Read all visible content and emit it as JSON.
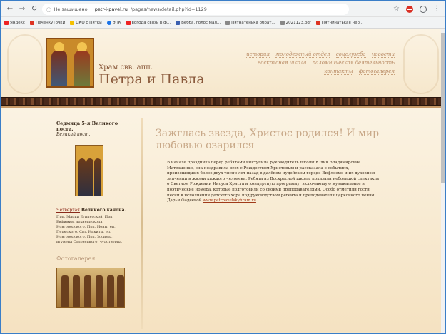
{
  "browser": {
    "url_prefix": "Не защищено",
    "url_host": "petr-i-pavel.ru",
    "url_path": "/pages/news/detail.php?id=1129",
    "bookmarks": [
      {
        "label": "Яндекс",
        "color": "#e22"
      },
      {
        "label": "ПечёнкуТочки",
        "color": "#d32"
      },
      {
        "label": "ЦКО с Пятки",
        "color": "#f5c000"
      },
      {
        "label": "ЭПК",
        "color": "#1a73e8"
      },
      {
        "label": "вогода связь р.ф...",
        "color": "#e22"
      },
      {
        "label": "Вебба. голос мал...",
        "color": "#3a5fb0"
      },
      {
        "label": "Пятнатенька обрат...",
        "color": "#888"
      },
      {
        "label": "2021123.pdf",
        "color": "#888"
      },
      {
        "label": "Пятничатькая нер...",
        "color": "#d32"
      }
    ]
  },
  "site": {
    "title_small": "Храм свв. апп.",
    "title_big": "Петра и Павла",
    "nav": [
      "история",
      "молодежный отдел",
      "соцслужба",
      "новости",
      "воскресная школа",
      "паломническая деятельность",
      "контакты",
      "фотогалерея"
    ]
  },
  "sidebar": {
    "title": "Седмица 5-я Великого поста.",
    "subtitle": "Великий пост.",
    "day_link": "Четвертая",
    "day_title": "Великого канона.",
    "text": "Прп. Марии Египетской. Прп. Евфимия, архиепископа Новгородского. Прп. Ионы, еп. Пермского. Свт. Никиты, еп. Новгородского. Прп. Зосимы, игумена Соловецкого, чудотворца.",
    "gallery_title": "Фотогалерея"
  },
  "article": {
    "headline": "Зажглась звезда, Христос родился! И мир любовью озарился",
    "body": "В начале праздника перед ребятами выступила руководитель школы Юлия Владимировна Матюшенко, она поздравила всех с Рождеством Христовым и рассказала о событиях, произошедших более двух тысяч лет назад в далёком иудейском городе Вифлееме и их духовном значении в жизни каждого человека. Ребята из Воскресной школы показали небольшой спектакль о Светлом Рождении Иисуса Христа и концертную программу, включающую музыкальные и поэтические номера, которые подготовили со своими преподавателями. Особо отметили гости песни в исполнении детского хора под руководством регента и преподавателя церковного пения Дарьи Фадеевой",
    "link": "www.petrpavelskyhram.ru"
  }
}
